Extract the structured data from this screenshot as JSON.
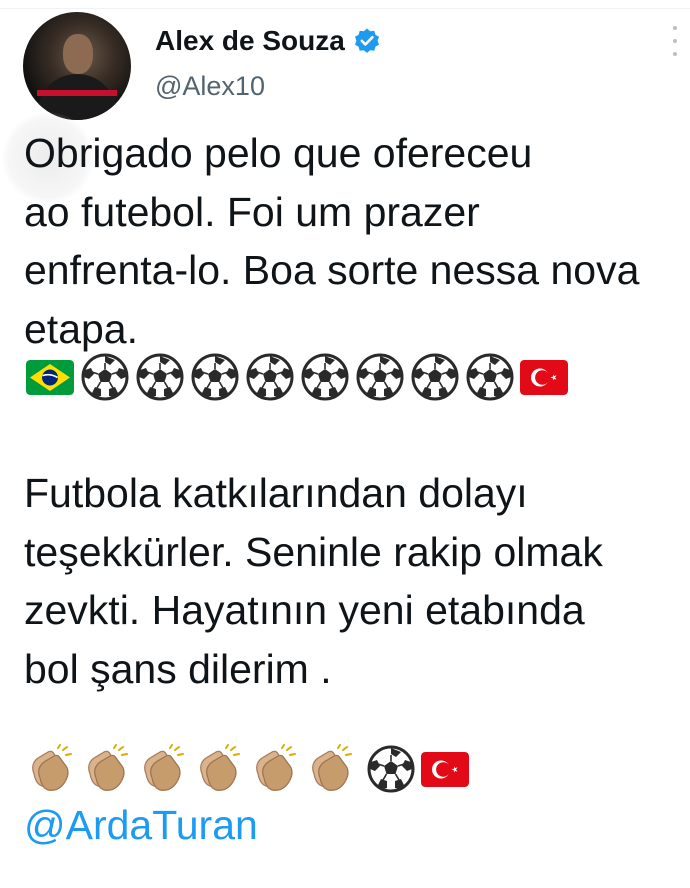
{
  "tweet": {
    "author": {
      "display_name": "Alex de Souza",
      "handle": "@Alex10",
      "verified": true,
      "verified_color": "#1d9bf0"
    },
    "text_pt": [
      "Obrigado pelo que ofereceu",
      "ao futebol. Foi um prazer",
      "enfrenta-lo. Boa sorte nessa nova",
      "etapa."
    ],
    "emoji_row_1": [
      "flag-brazil",
      "soccer-ball",
      "soccer-ball",
      "soccer-ball",
      "soccer-ball",
      "soccer-ball",
      "soccer-ball",
      "soccer-ball",
      "soccer-ball",
      "flag-turkey"
    ],
    "text_tr": [
      " Futbola katkılarından dolayı",
      "teşekkürler. Seninle rakip olmak",
      "zevkti. Hayatının yeni etabında",
      "bol şans dilerim ."
    ],
    "emoji_row_2": [
      "clapping-hands",
      "clapping-hands",
      "clapping-hands",
      "clapping-hands",
      "clapping-hands",
      "clapping-hands",
      "soccer-ball",
      "flag-turkey"
    ],
    "mention": "@ArdaTuran",
    "colors": {
      "text": "#0f1419",
      "secondary": "#536471",
      "link": "#1d9bf0",
      "turkey_red": "#e30a17",
      "brazil_green": "#009c3b",
      "brazil_yellow": "#ffdf00",
      "brazil_blue": "#002776"
    }
  }
}
